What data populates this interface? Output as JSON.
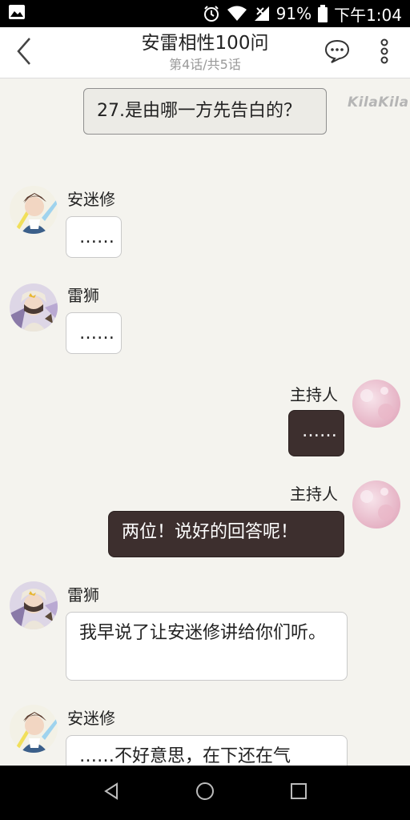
{
  "status_bar": {
    "battery": "91%",
    "time": "下午1:04",
    "icons": [
      "image-icon",
      "alarm-icon",
      "wifi-icon",
      "signal-icon",
      "battery-icon"
    ]
  },
  "header": {
    "title": "安雷相性100问",
    "subtitle": "第4话/共5话",
    "icons": [
      "back-icon",
      "comment-icon",
      "more-icon"
    ]
  },
  "watermark": "KilaKila",
  "messages": [
    {
      "type": "narration",
      "text": "27.是由哪一方先告白的？"
    },
    {
      "type": "left",
      "speaker": "安迷修",
      "text": "……"
    },
    {
      "type": "left",
      "speaker": "雷狮",
      "text": "……"
    },
    {
      "type": "right",
      "speaker": "主持人",
      "text": "……"
    },
    {
      "type": "right",
      "speaker": "主持人",
      "text": "两位！说好的回答呢！"
    },
    {
      "type": "left",
      "speaker": "雷狮",
      "text": "我早说了让安迷修讲给你们听。"
    },
    {
      "type": "left",
      "speaker": "安迷修",
      "text": "……不好意思，在下还在气"
    }
  ],
  "colors": {
    "background": "#f4f3ee",
    "dark_bubble": "#3d2f2e",
    "narration_bg": "#ecebe6"
  },
  "nav_bar": {
    "icons": [
      "nav-back-icon",
      "nav-home-icon",
      "nav-recents-icon"
    ]
  }
}
